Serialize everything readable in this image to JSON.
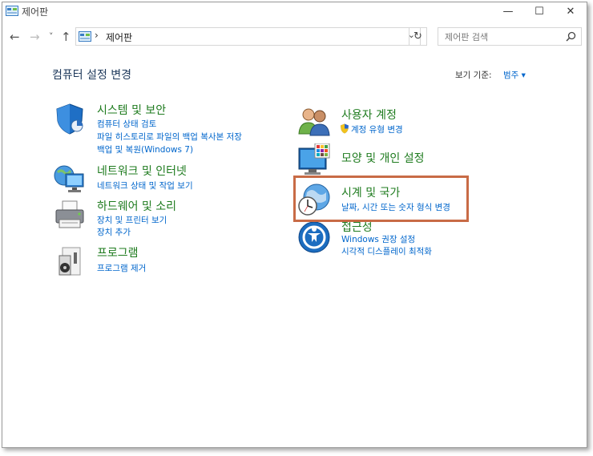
{
  "window": {
    "title": "제어판",
    "minimize_glyph": "—",
    "maximize_glyph": "☐",
    "close_glyph": "✕"
  },
  "nav": {
    "back_glyph": "←",
    "forward_glyph": "→",
    "recent_glyph": "˅",
    "up_glyph": "↑",
    "breadcrumb_sep": "›",
    "address": "제어판",
    "address_dropdown_glyph": "⌄",
    "refresh_glyph": "↻",
    "search_placeholder": "제어판 검색"
  },
  "main": {
    "heading": "컴퓨터 설정 변경",
    "view_by_label": "보기 기준:",
    "view_by_value": "범주 ▾"
  },
  "categories_left": [
    {
      "title": "시스템 및 보안",
      "icon": "shield-icon",
      "links": [
        "컴퓨터 상태 검토",
        "파일 히스토리로 파일의 백업 복사본 저장",
        "백업 및 복원(Windows 7)"
      ]
    },
    {
      "title": "네트워크 및 인터넷",
      "icon": "network-icon",
      "links": [
        "네트워크 상태 및 작업 보기"
      ]
    },
    {
      "title": "하드웨어 및 소리",
      "icon": "printer-icon",
      "links": [
        "장치 및 프린터 보기",
        "장치 추가"
      ]
    },
    {
      "title": "프로그램",
      "icon": "programs-icon",
      "links": [
        "프로그램 제거"
      ]
    }
  ],
  "categories_right": [
    {
      "title": "사용자 계정",
      "icon": "users-icon",
      "links": [
        "계정 유형 변경"
      ]
    },
    {
      "title": "모양 및 개인 설정",
      "icon": "personalization-icon",
      "links": []
    },
    {
      "title": "시계 및 국가",
      "icon": "clock-globe-icon",
      "links": [
        "날짜, 시간 또는 숫자 형식 변경"
      ]
    },
    {
      "title": "접근성",
      "icon": "ease-of-access-icon",
      "links": [
        "Windows 권장 설정",
        "시각적 디스플레이 최적화"
      ]
    }
  ],
  "colors": {
    "category_title": "#1e7b1e",
    "link": "#0066cc",
    "highlight_border": "#c86b46"
  }
}
